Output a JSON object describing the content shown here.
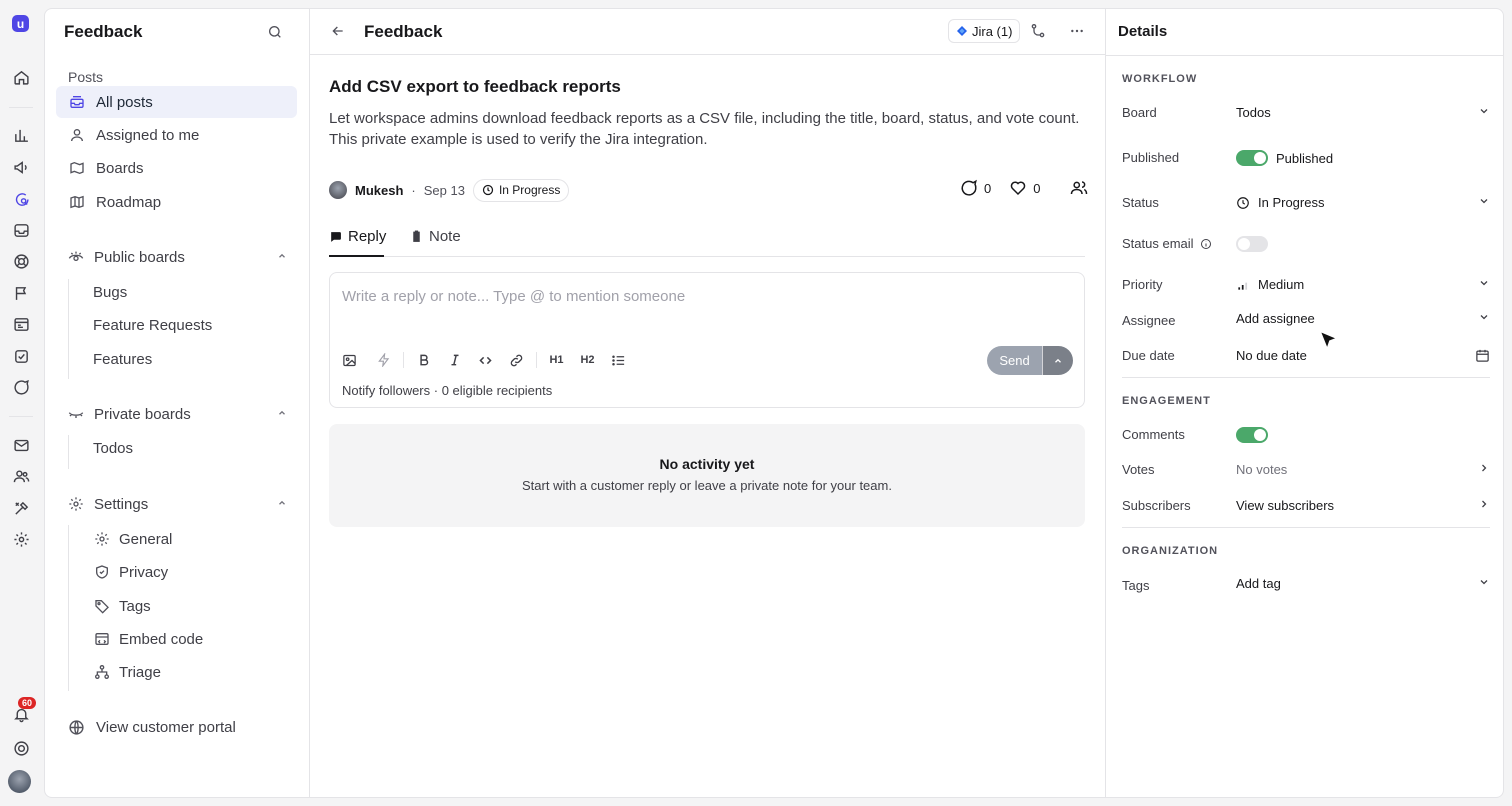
{
  "rail": {
    "logo": "u",
    "notifications": "60"
  },
  "sidebar": {
    "title": "Feedback",
    "posts_label": "Posts",
    "nav": [
      {
        "label": "All posts"
      },
      {
        "label": "Assigned to me"
      },
      {
        "label": "Boards"
      },
      {
        "label": "Roadmap"
      }
    ],
    "public_boards": {
      "label": "Public boards",
      "items": [
        "Bugs",
        "Feature Requests",
        "Features"
      ]
    },
    "private_boards": {
      "label": "Private boards",
      "items": [
        "Todos"
      ]
    },
    "settings": {
      "label": "Settings",
      "items": [
        "General",
        "Privacy",
        "Tags",
        "Embed code",
        "Triage"
      ]
    },
    "portal": "View customer portal"
  },
  "main": {
    "title": "Feedback",
    "jira": "Jira (1)",
    "post": {
      "title": "Add CSV export to feedback reports",
      "body": "Let workspace admins download feedback reports as a CSV file, including the title, board, status, and vote count. This private example is used to verify the Jira integration.",
      "author": "Mukesh",
      "dot": "·",
      "date": "Sep 13",
      "status": "In Progress",
      "comments": "0",
      "likes": "0"
    },
    "tabs": {
      "reply": "Reply",
      "note": "Note"
    },
    "editor": {
      "placeholder": "Write a reply or note... Type @ to mention someone",
      "h1": "H1",
      "h2": "H2",
      "send": "Send",
      "notify": "Notify followers · 0 eligible recipients"
    },
    "activity": {
      "title": "No activity yet",
      "subtitle": "Start with a customer reply or leave a private note for your team."
    }
  },
  "details": {
    "title": "Details",
    "workflow": {
      "label": "WORKFLOW",
      "board": {
        "label": "Board",
        "value": "Todos"
      },
      "published": {
        "label": "Published",
        "value": "Published",
        "on": true
      },
      "status": {
        "label": "Status",
        "value": "In Progress"
      },
      "status_email": {
        "label": "Status email",
        "on": false
      },
      "priority": {
        "label": "Priority",
        "value": "Medium"
      },
      "assignee": {
        "label": "Assignee",
        "value": "Add assignee"
      },
      "due_date": {
        "label": "Due date",
        "value": "No due date"
      }
    },
    "engagement": {
      "label": "ENGAGEMENT",
      "comments": {
        "label": "Comments",
        "on": true
      },
      "votes": {
        "label": "Votes",
        "value": "No votes"
      },
      "subscribers": {
        "label": "Subscribers",
        "value": "View subscribers"
      }
    },
    "organization": {
      "label": "ORGANIZATION",
      "tags": {
        "label": "Tags",
        "value": "Add tag"
      }
    }
  },
  "colors": {
    "accent": "#4f46e5",
    "toggle_on": "#4ba86a",
    "badge": "#dc2626"
  }
}
